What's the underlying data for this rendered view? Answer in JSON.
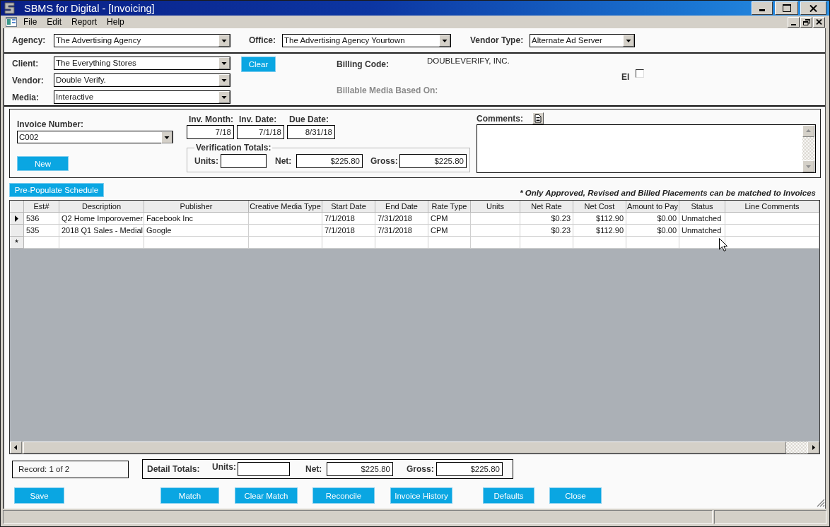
{
  "window": {
    "title": "SBMS for Digital - [Invoicing]"
  },
  "menu": [
    "File",
    "Edit",
    "Report",
    "Help"
  ],
  "header_filters": [
    {
      "label": "Agency:",
      "value": "The Advertising Agency"
    },
    {
      "label": "Office:",
      "value": "The Advertising Agency Yourtown"
    },
    {
      "label": "Vendor Type:",
      "value": "Alternate Ad Server"
    }
  ],
  "selection": {
    "fields": [
      {
        "label": "Client:",
        "value": "The Everything Stores"
      },
      {
        "label": "Vendor:",
        "value": "Double Verify."
      },
      {
        "label": "Media:",
        "value": "Interactive"
      }
    ],
    "clear_button": "Clear",
    "billing_code": {
      "label": "Billing Code:",
      "value": "DOUBLEVERIFY, INC."
    },
    "ei": {
      "label": "EI",
      "checked": false
    },
    "billable_media": {
      "label": "Billable Media Based On:",
      "disabled": true
    }
  },
  "invoice": {
    "number": {
      "label": "Invoice Number:",
      "value": "C002"
    },
    "new_button": "New",
    "dates": [
      {
        "label": "Inv. Month:",
        "value": "7/18"
      },
      {
        "label": "Inv. Date:",
        "value": "7/1/18"
      },
      {
        "label": "Due Date:",
        "value": "8/31/18"
      }
    ],
    "verification_totals": {
      "title": "Verification Totals:",
      "fields": [
        {
          "label": "Units:"
        },
        {
          "label": "Net:",
          "value": "$225.80"
        },
        {
          "label": "Gross:",
          "value": "$225.80"
        }
      ]
    },
    "comments": {
      "label": "Comments:"
    }
  },
  "schedule_button": "Pre-Populate Schedule",
  "note": "* Only Approved, Revised and Billed Placements can be matched to Invoices",
  "grid": {
    "columns": [
      "Est#",
      "Description",
      "Publisher",
      "Creative Media Type",
      "Start Date",
      "End Date",
      "Rate Type",
      "Units",
      "Net Rate",
      "Net Cost",
      "Amount to Pay",
      "Status",
      "Line Comments"
    ],
    "rows": [
      {
        "selected": true,
        "cells": [
          "536",
          "Q2 Home Imporovemer",
          "Facebook Inc",
          null,
          "7/1/2018",
          "7/31/2018",
          "CPM",
          null,
          "$0.23",
          "$112.90",
          "$0.00",
          "Unmatched",
          null
        ]
      },
      {
        "selected": false,
        "cells": [
          "535",
          "2018 Q1 Sales - Medial",
          "Google",
          null,
          "7/1/2018",
          "7/31/2018",
          "CPM",
          null,
          "$0.23",
          "$112.90",
          "$0.00",
          "Unmatched",
          null
        ]
      }
    ],
    "new_row_marker": "*"
  },
  "record": "Record: 1 of 2",
  "detail_totals": {
    "title": "Detail Totals:",
    "fields": [
      {
        "label": "Units:"
      },
      {
        "label": "Net:",
        "value": "$225.80"
      },
      {
        "label": "Gross:",
        "value": "$225.80"
      }
    ]
  },
  "buttons": [
    "Save",
    "Match",
    "Clear Match",
    "Reconcile",
    "Invoice History",
    "Defaults",
    "Close"
  ]
}
